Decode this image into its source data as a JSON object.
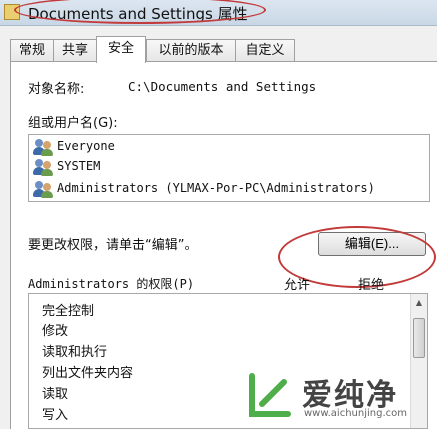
{
  "window": {
    "title": "Documents and Settings 属性"
  },
  "tabs": [
    {
      "label": "常规",
      "active": false
    },
    {
      "label": "共享",
      "active": false
    },
    {
      "label": "安全",
      "active": true
    },
    {
      "label": "以前的版本",
      "active": false
    },
    {
      "label": "自定义",
      "active": false
    }
  ],
  "security": {
    "object_name_label": "对象名称:",
    "object_name_value": "C:\\Documents and Settings",
    "group_label": "组或用户名(G):",
    "users": [
      {
        "name": "Everyone"
      },
      {
        "name": "SYSTEM"
      },
      {
        "name": "Administrators (YLMAX-Por-PC\\Administrators)"
      }
    ],
    "change_hint": "要更改权限，请单击“编辑”。",
    "edit_button_label": "编辑(E)...",
    "permissions_label": "Administrators 的权限(P)",
    "allow_header": "允许",
    "deny_header": "拒绝",
    "permissions": [
      "完全控制",
      "修改",
      "读取和执行",
      "列出文件夹内容",
      "读取",
      "写入"
    ]
  },
  "watermark": {
    "name": "爱纯净",
    "url": "www.aichunjing.com"
  },
  "colors": {
    "annotation_red": "#c23a3a",
    "watermark_green": "#4fae4a"
  }
}
